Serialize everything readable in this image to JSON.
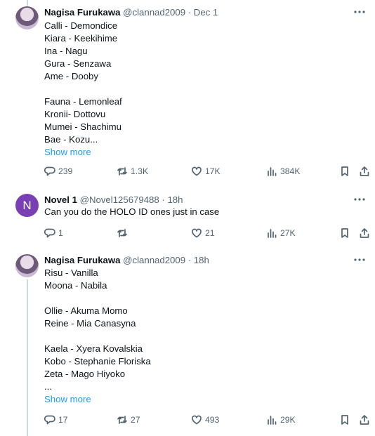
{
  "tweets": [
    {
      "name": "Nagisa Furukawa",
      "handle": "@clannad2009",
      "time": "Dec 1",
      "lines": [
        "Calli - Demondice",
        "Kiara - Keekihime",
        "Ina - Nagu",
        "Gura - Senzawa",
        "Ame - Dooby",
        "",
        "Fauna - Lemonleaf",
        "Kronii- Dottovu",
        "Mumei - Shachimu",
        "Bae - Kozu..."
      ],
      "show_more": "Show more",
      "replies": "239",
      "reposts": "1.3K",
      "likes": "17K",
      "views": "384K"
    },
    {
      "name": "Novel 1",
      "handle": "@Novel125679488",
      "time": "18h",
      "avatar_letter": "N",
      "lines": [
        "Can you do the HOLO ID ones just in case"
      ],
      "replies": "1",
      "reposts": "",
      "likes": "21",
      "views": "27K"
    },
    {
      "name": "Nagisa Furukawa",
      "handle": "@clannad2009",
      "time": "18h",
      "lines": [
        "Risu - Vanilla",
        "Moona - Nabila",
        "",
        "Ollie - Akuma Momo",
        "Reine - Mia Canasyna",
        "",
        "Kaela - Xyera Kovalskia",
        "Kobo - Stephanie Floriska",
        "Zeta - Mago Hiyoko",
        "..."
      ],
      "show_more": "Show more",
      "replies": "17",
      "reposts": "27",
      "likes": "493",
      "views": "29K"
    }
  ],
  "separator": " · ",
  "icons": [
    "more-icon",
    "reply-icon",
    "repost-icon",
    "like-icon",
    "views-icon",
    "bookmark-icon",
    "share-icon"
  ],
  "colors": {
    "link": "#1d9bf0",
    "muted": "#536471",
    "avatar_n": "#7b3fb5"
  }
}
